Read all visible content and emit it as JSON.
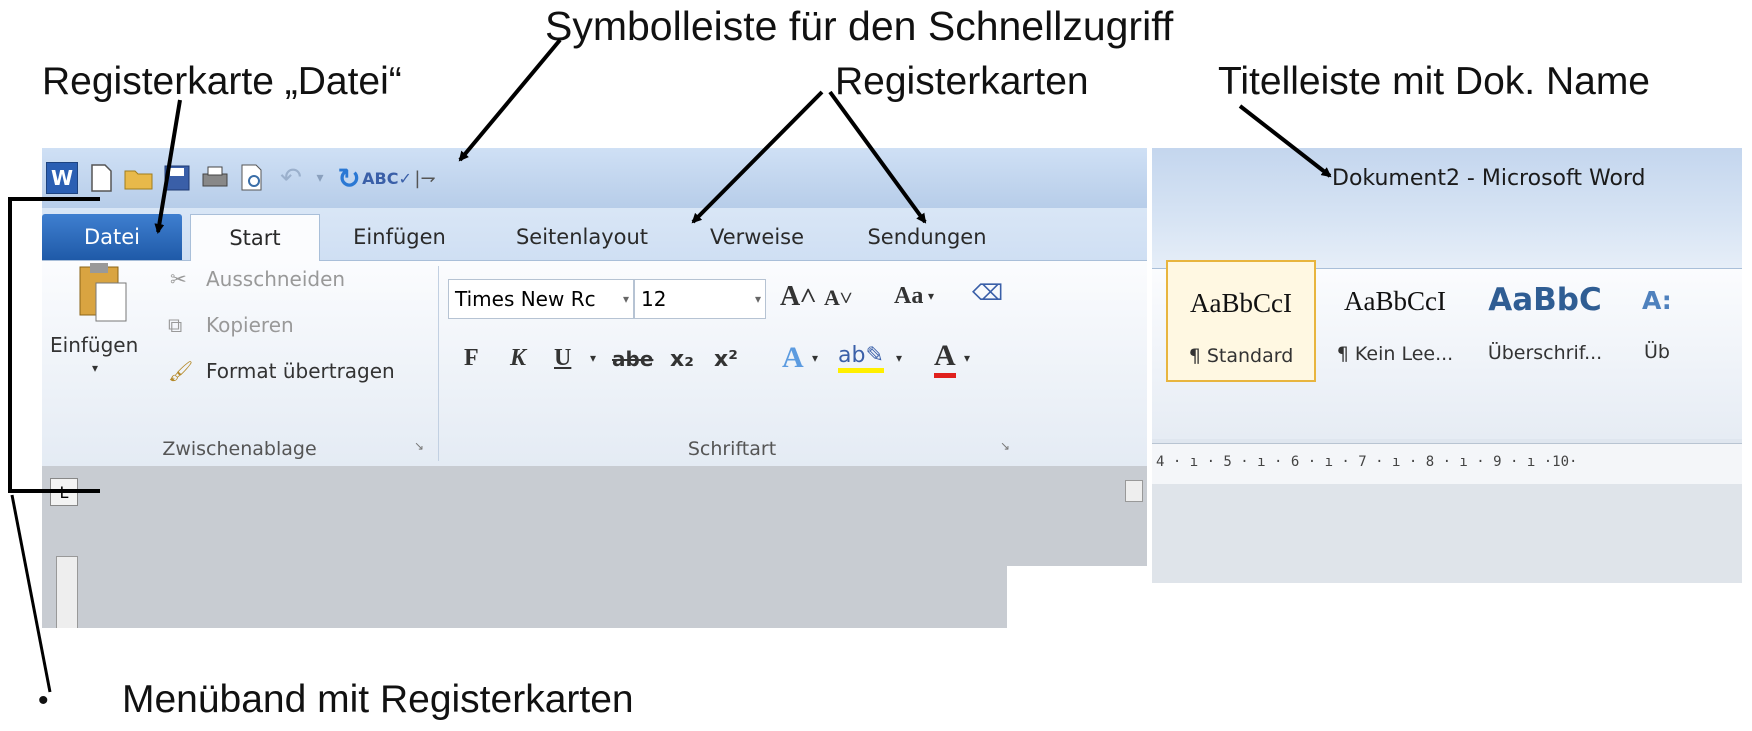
{
  "annotations": {
    "qat": "Symbolleiste für den Schnellzugriff",
    "datei_tab": "Registerkarte „Datei“",
    "tabs": "Registerkarten",
    "titlebar": "Titelleiste mit Dok. Name",
    "ribbon": "Menüband mit Registerkarten",
    "bullet": "•"
  },
  "window": {
    "title": "Dokument2 - Microsoft Word",
    "app_icon": "word-icon"
  },
  "quick_access": {
    "icons": [
      "new-document-icon",
      "open-folder-icon",
      "save-icon",
      "print-icon",
      "print-preview-icon",
      "undo-icon",
      "redo-icon",
      "spellcheck-icon",
      "customize-dropdown-icon"
    ]
  },
  "tabs": [
    "Datei",
    "Start",
    "Einfügen",
    "Seitenlayout",
    "Verweise",
    "Sendungen"
  ],
  "clipboard": {
    "paste_label": "Einfügen",
    "cut": "Ausschneiden",
    "copy": "Kopieren",
    "format_painter": "Format übertragen",
    "group_label": "Zwischenablage"
  },
  "font": {
    "font_name": "Times New Rc",
    "font_size": "12",
    "bold": "F",
    "italic": "K",
    "underline": "U",
    "strike": "abe",
    "subscript": "x₂",
    "superscript": "x²",
    "change_case": "Aa",
    "group_label": "Schriftart"
  },
  "styles": [
    {
      "preview": "AaBbCcI",
      "name": "¶ Standard"
    },
    {
      "preview": "AaBbCcI",
      "name": "¶ Kein Lee..."
    },
    {
      "preview": "AaBbC",
      "name": "Überschrif..."
    },
    {
      "preview": "A:",
      "name": "Üb"
    }
  ],
  "ruler": {
    "text": "4 · ı · 5 · ı · 6 · ı · 7 · ı · 8 · ı · 9 · ı ·10·"
  },
  "colors": {
    "datei_tab": "#2b6bbf",
    "title_bg": "#c6d9f1",
    "style_selected_border": "#e8b53e"
  }
}
